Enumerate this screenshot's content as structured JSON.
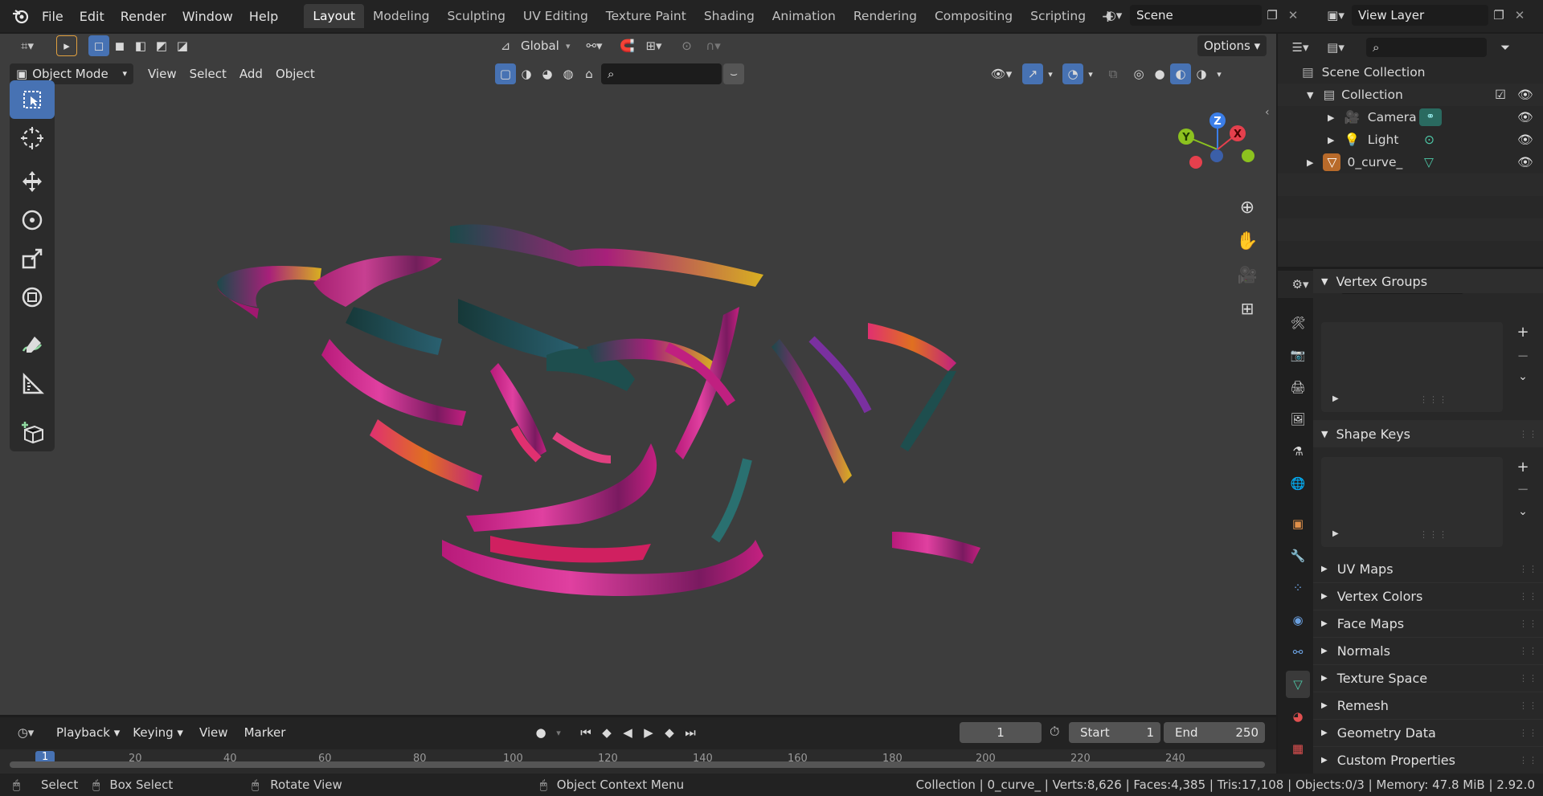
{
  "menu": {
    "file": "File",
    "edit": "Edit",
    "render": "Render",
    "window": "Window",
    "help": "Help"
  },
  "workspaces": [
    "Layout",
    "Modeling",
    "Sculpting",
    "UV Editing",
    "Texture Paint",
    "Shading",
    "Animation",
    "Rendering",
    "Compositing",
    "Scripting"
  ],
  "active_workspace": "Layout",
  "scene": {
    "name": "Scene"
  },
  "view_layer": {
    "name": "View Layer"
  },
  "viewport_header": {
    "transform_orientation": "Global",
    "options": "Options",
    "mode": "Object Mode",
    "menus": [
      "View",
      "Select",
      "Add",
      "Object"
    ]
  },
  "gizmo": {
    "x": "X",
    "y": "Y",
    "z": "Z"
  },
  "outliner": {
    "scene_collection": "Scene Collection",
    "collection": "Collection",
    "items": [
      {
        "label": "Camera"
      },
      {
        "label": "Light"
      },
      {
        "label": "0_curve_"
      }
    ]
  },
  "properties": {
    "sections": [
      "Vertex Groups",
      "Shape Keys",
      "UV Maps",
      "Vertex Colors",
      "Face Maps",
      "Normals",
      "Texture Space",
      "Remesh",
      "Geometry Data",
      "Custom Properties"
    ]
  },
  "timeline": {
    "menus": [
      "Playback",
      "Keying",
      "View",
      "Marker"
    ],
    "current_frame": "1",
    "start_label": "Start",
    "start": "1",
    "end_label": "End",
    "end": "250",
    "ticks": [
      "1",
      "20",
      "40",
      "60",
      "80",
      "100",
      "120",
      "140",
      "160",
      "180",
      "200",
      "220",
      "240"
    ]
  },
  "statusbar": {
    "select": "Select",
    "box_select": "Box Select",
    "rotate": "Rotate View",
    "context": "Object Context Menu",
    "stats": "Collection | 0_curve_ | Verts:8,626 | Faces:4,385 | Tris:17,108 | Objects:0/3 | Memory: 47.8 MiB | 2.92.0"
  },
  "colors": {
    "accent": "#4772b3",
    "active_tab": "#3a3a3a",
    "x_axis": "#e5404d",
    "y_axis": "#8cc21f",
    "z_axis": "#3b7ee8"
  }
}
